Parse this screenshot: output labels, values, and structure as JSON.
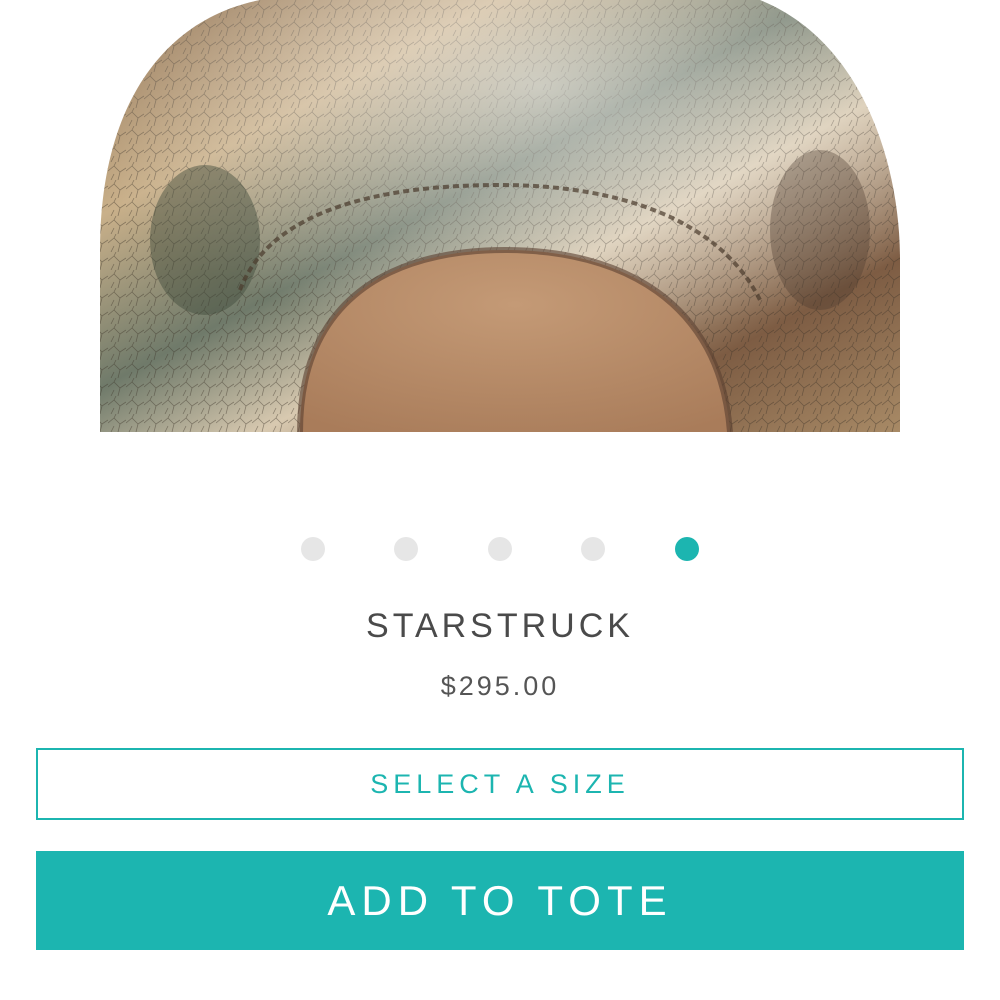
{
  "product": {
    "image_icon": "product-photo",
    "name": "STARSTRUCK",
    "price": "$295.00"
  },
  "carousel": {
    "dot_count": 5,
    "active_index": 4
  },
  "actions": {
    "select_size_label": "SELECT A SIZE",
    "add_to_tote_label": "ADD TO TOTE"
  },
  "colors": {
    "accent": "#1cb5b0",
    "inactive_dot": "#e6e6e6",
    "text": "#4a4a4a"
  }
}
